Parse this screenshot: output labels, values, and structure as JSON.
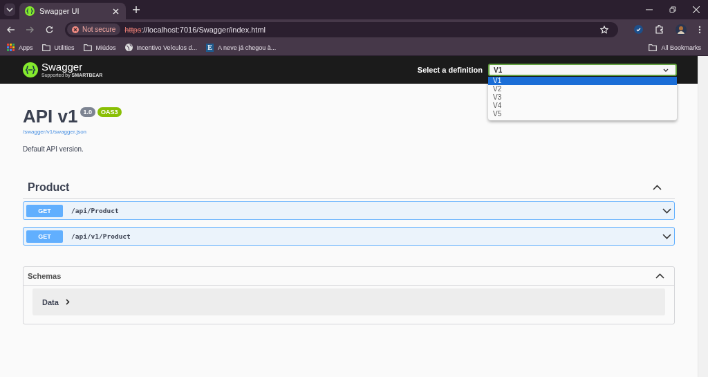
{
  "browser": {
    "tab": {
      "title": "Swagger UI"
    },
    "security": "Not secure",
    "url_scheme": "https",
    "url_rest": "://localhost:7016/Swagger/index.html",
    "bookmarks": [
      {
        "kind": "apps",
        "label": "Apps"
      },
      {
        "kind": "folder",
        "label": "Utilities"
      },
      {
        "kind": "folder",
        "label": "Miúdos"
      },
      {
        "kind": "globe",
        "label": "Incentivo Veículos d..."
      },
      {
        "kind": "letter",
        "icon": "E",
        "label": "A neve já chegou à..."
      }
    ],
    "all_bookmarks": "All Bookmarks"
  },
  "topbar": {
    "brand": "Swagger",
    "supported_by": "Supported by",
    "vendor": "SMARTBEAR",
    "definition_label": "Select a definition",
    "definition_value": "V1",
    "options": [
      {
        "label": "V1",
        "selected": true
      },
      {
        "label": "V2",
        "selected": false
      },
      {
        "label": "V3",
        "selected": false
      },
      {
        "label": "V4",
        "selected": false
      },
      {
        "label": "V5",
        "selected": false
      }
    ]
  },
  "info": {
    "title": "API v1",
    "version": "1.0",
    "oas": "OAS3",
    "spec_link": "/swagger/v1/swagger.json",
    "description": "Default API version."
  },
  "tags": [
    {
      "name": "Product",
      "expanded": true,
      "operations": [
        {
          "method": "GET",
          "path": "/api/Product"
        },
        {
          "method": "GET",
          "path": "/api/v1/Product"
        }
      ]
    }
  ],
  "schemas": {
    "title": "Schemas",
    "expanded": true,
    "models": [
      {
        "name": "Data"
      }
    ]
  }
}
